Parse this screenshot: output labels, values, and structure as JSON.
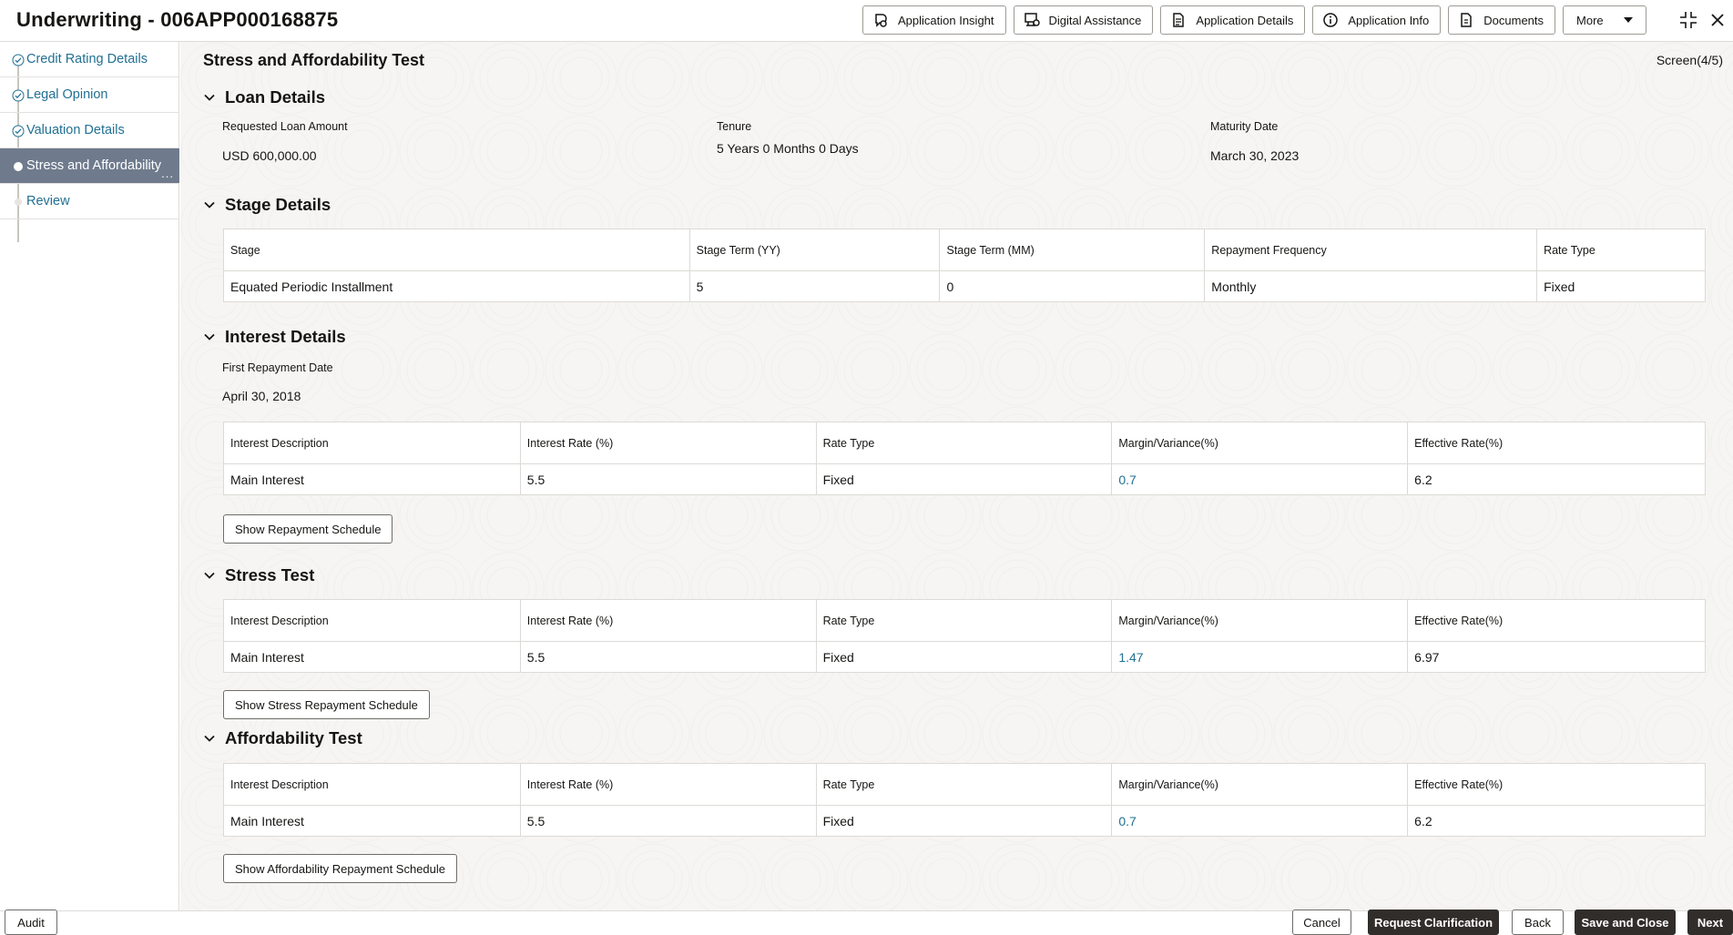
{
  "header": {
    "title": "Underwriting - 006APP000168875",
    "buttons": {
      "application_insight": "Application Insight",
      "digital_assistance": "Digital Assistance",
      "application_details": "Application Details",
      "application_info": "Application Info",
      "documents": "Documents",
      "more": "More"
    }
  },
  "sidebar": {
    "items": [
      {
        "label": "Credit Rating Details",
        "state": "completed"
      },
      {
        "label": "Legal Opinion",
        "state": "completed"
      },
      {
        "label": "Valuation Details",
        "state": "completed"
      },
      {
        "label": "Stress and Affordability",
        "state": "active"
      },
      {
        "label": "Review",
        "state": "pending"
      }
    ],
    "active_ellipsis": "..."
  },
  "main": {
    "title": "Stress and Affordability Test",
    "screen_count": "Screen(4/5)",
    "loan_details": {
      "heading": "Loan Details",
      "requested_amount_label": "Requested Loan Amount",
      "requested_amount_value": "USD 600,000.00",
      "tenure_label": "Tenure",
      "tenure_value": "5 Years 0 Months 0 Days",
      "maturity_label": "Maturity Date",
      "maturity_value": "March 30, 2023"
    },
    "stage_details": {
      "heading": "Stage Details",
      "columns": [
        "Stage",
        "Stage Term (YY)",
        "Stage Term (MM)",
        "Repayment Frequency",
        "Rate Type"
      ],
      "row": [
        "Equated Periodic Installment",
        "5",
        "0",
        "Monthly",
        "Fixed"
      ]
    },
    "interest_details": {
      "heading": "Interest Details",
      "first_repayment_label": "First Repayment Date",
      "first_repayment_value": "April 30, 2018",
      "columns": [
        "Interest Description",
        "Interest Rate (%)",
        "Rate Type",
        "Margin/Variance(%)",
        "Effective Rate(%)"
      ],
      "row": [
        "Main Interest",
        "5.5",
        "Fixed",
        "0.7",
        "6.2"
      ],
      "button": "Show Repayment Schedule"
    },
    "stress_test": {
      "heading": "Stress Test",
      "columns": [
        "Interest Description",
        "Interest Rate (%)",
        "Rate Type",
        "Margin/Variance(%)",
        "Effective Rate(%)"
      ],
      "row": [
        "Main Interest",
        "5.5",
        "Fixed",
        "1.47",
        "6.97"
      ],
      "button": "Show Stress Repayment Schedule"
    },
    "affordability_test": {
      "heading": "Affordability Test",
      "columns": [
        "Interest Description",
        "Interest Rate (%)",
        "Rate Type",
        "Margin/Variance(%)",
        "Effective Rate(%)"
      ],
      "row": [
        "Main Interest",
        "5.5",
        "Fixed",
        "0.7",
        "6.2"
      ],
      "button": "Show Affordability Repayment Schedule"
    }
  },
  "footer": {
    "audit": "Audit",
    "cancel": "Cancel",
    "request_clarification": "Request Clarification",
    "back": "Back",
    "save_and_close": "Save and Close",
    "next": "Next"
  },
  "colors": {
    "link": "#227093",
    "active_nav": "#6f7b8d",
    "dark_button": "#312d2a"
  }
}
